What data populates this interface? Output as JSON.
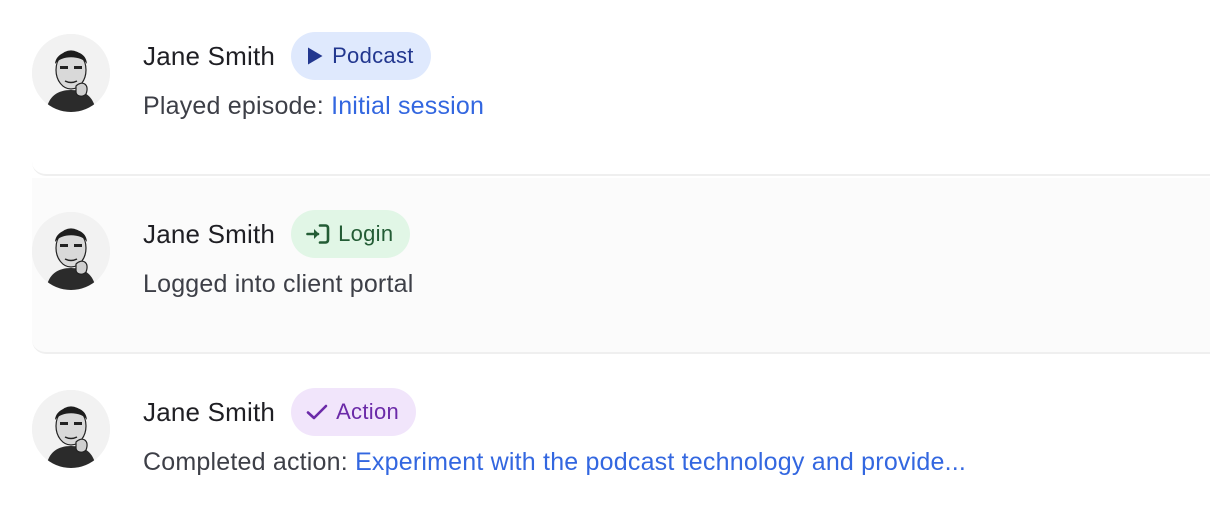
{
  "activities": [
    {
      "user": "Jane Smith",
      "badge": {
        "label": "Podcast",
        "icon": "play-icon",
        "bg": "#dfe9fd",
        "fg": "#22378f"
      },
      "prefix": "Played episode: ",
      "link": "Initial session"
    },
    {
      "user": "Jane Smith",
      "badge": {
        "label": "Login",
        "icon": "login-icon",
        "bg": "#e1f6e6",
        "fg": "#235c35"
      },
      "prefix": "Logged into client portal",
      "link": ""
    },
    {
      "user": "Jane Smith",
      "badge": {
        "label": "Action",
        "icon": "check-icon",
        "bg": "#f1e5fb",
        "fg": "#6b2aa8"
      },
      "prefix": "Completed action: ",
      "link": "Experiment with the podcast technology and provide..."
    }
  ],
  "colors": {
    "link": "#3367e0",
    "text": "#3d3f47",
    "name": "#1f1f24",
    "divider": "#efefef"
  }
}
